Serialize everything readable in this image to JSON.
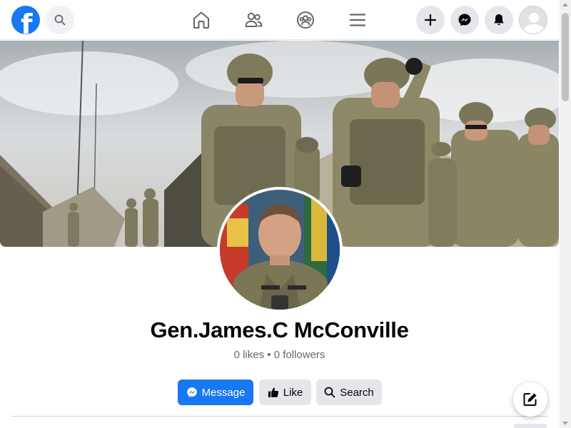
{
  "topbar": {
    "logo_letter": "f",
    "icons": {
      "logo": "facebook-logo",
      "search": "search-icon",
      "home": "home-icon",
      "friends": "friends-icon",
      "groups": "groups-icon",
      "menu": "menu-icon",
      "create": "plus-icon",
      "messenger": "messenger-icon",
      "notifications": "bell-icon",
      "account": "avatar"
    }
  },
  "profile": {
    "name": "Gen.James.C McConville",
    "likes": "0 likes",
    "separator": "•",
    "followers": "0 followers"
  },
  "actions": {
    "message_label": "Message",
    "like_label": "Like",
    "search_label": "Search"
  },
  "colors": {
    "brand": "#1877f2",
    "button_gray": "#e4e6eb",
    "muted_text": "#65676b"
  }
}
